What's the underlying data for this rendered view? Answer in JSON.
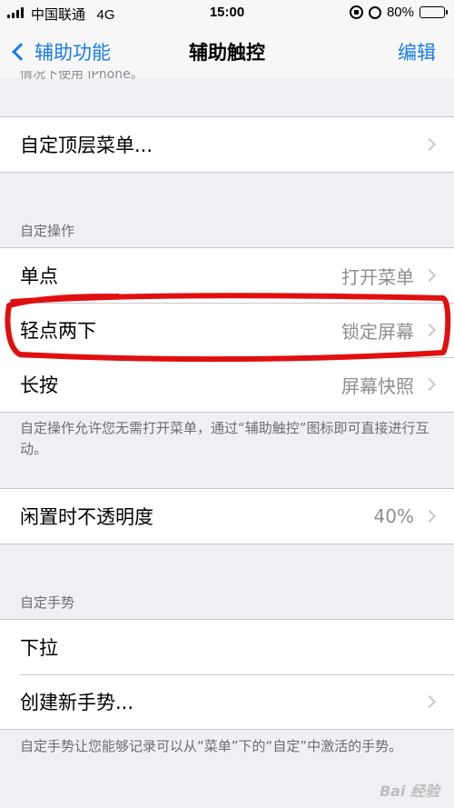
{
  "status_bar": {
    "carrier": "中国联通",
    "network": "4G",
    "time": "15:00",
    "battery": "80%",
    "battery_level": 0.8
  },
  "nav": {
    "back_label": "辅助功能",
    "title": "辅助触控",
    "edit_label": "编辑"
  },
  "partial_text": "情况下使用 iPhone。",
  "top_group": {
    "custom_menu": "自定顶层菜单..."
  },
  "custom_actions": {
    "header": "自定操作",
    "rows": [
      {
        "label": "单点",
        "value": "打开菜单"
      },
      {
        "label": "轻点两下",
        "value": "锁定屏幕"
      },
      {
        "label": "长按",
        "value": "屏幕快照"
      }
    ],
    "footer": "自定操作允许您无需打开菜单，通过“辅助触控”图标即可直接进行互动。"
  },
  "opacity": {
    "label": "闲置时不透明度",
    "value": "40%"
  },
  "custom_gestures": {
    "header": "自定手势",
    "rows": [
      {
        "label": "下拉"
      },
      {
        "label": "创建新手势..."
      }
    ],
    "footer": "自定手势让您能够记录可以从“菜单”下的“自定”中激活的手势。"
  },
  "watermark": "Bai 经验",
  "colors": {
    "accent": "#1a7bf0",
    "highlight": "#e01010",
    "background": "#efeff4"
  }
}
